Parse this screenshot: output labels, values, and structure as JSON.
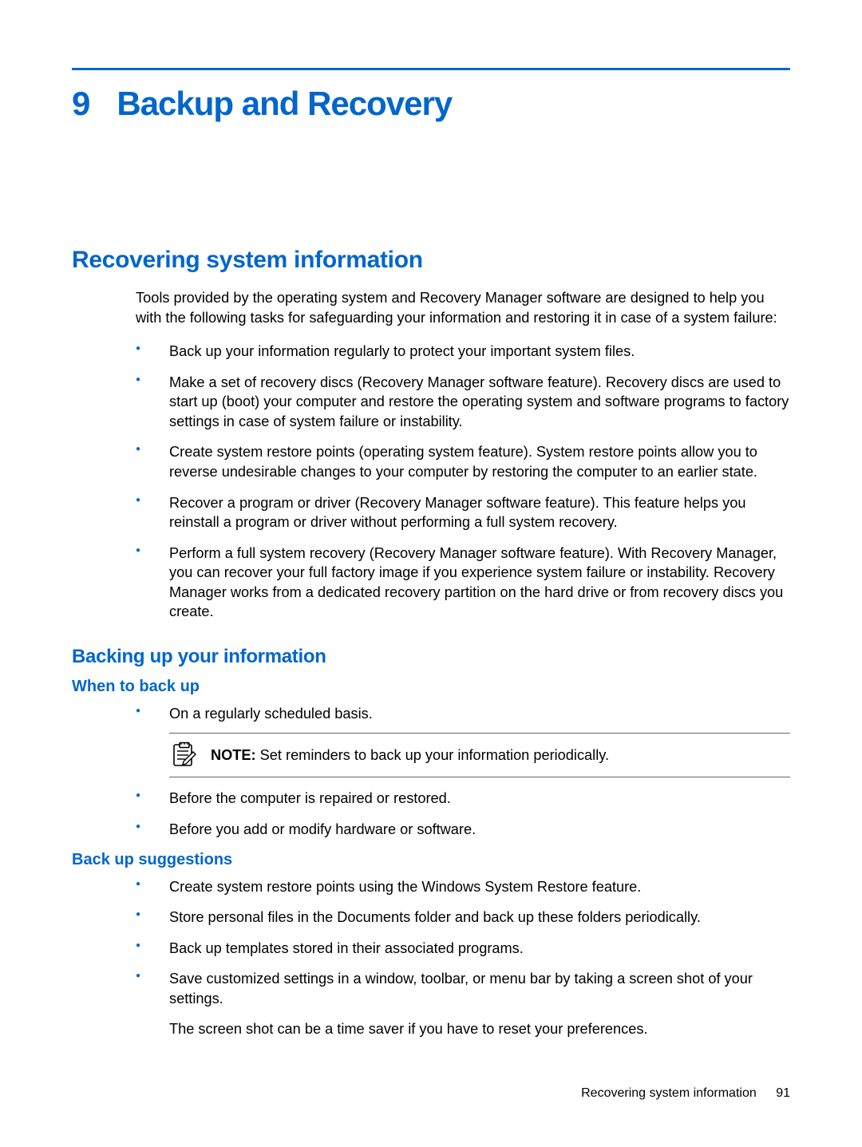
{
  "chapter": {
    "number": "9",
    "title": "Backup and Recovery"
  },
  "section": {
    "heading": "Recovering system information",
    "intro": "Tools provided by the operating system and Recovery Manager software are designed to help you with the following tasks for safeguarding your information and restoring it in case of a system failure:",
    "bullets": [
      "Back up your information regularly to protect your important system files.",
      "Make a set of recovery discs (Recovery Manager software feature). Recovery discs are used to start up (boot) your computer and restore the operating system and software programs to factory settings in case of system failure or instability.",
      "Create system restore points (operating system feature). System restore points allow you to reverse undesirable changes to your computer by restoring the computer to an earlier state.",
      "Recover a program or driver (Recovery Manager software feature). This feature helps you reinstall a program or driver without performing a full system recovery.",
      "Perform a full system recovery (Recovery Manager software feature). With Recovery Manager, you can recover your full factory image if you experience system failure or instability. Recovery Manager works from a dedicated recovery partition on the hard drive or from recovery discs you create."
    ]
  },
  "subsection": {
    "heading": "Backing up your information",
    "when": {
      "heading": "When to back up",
      "items_before_note": [
        "On a regularly scheduled basis."
      ],
      "note": {
        "label": "NOTE:",
        "text": "Set reminders to back up your information periodically."
      },
      "items_after_note": [
        "Before the computer is repaired or restored.",
        "Before you add or modify hardware or software."
      ]
    },
    "suggestions": {
      "heading": "Back up suggestions",
      "items": [
        "Create system restore points using the Windows System Restore feature.",
        "Store personal files in the Documents folder and back up these folders periodically.",
        "Back up templates stored in their associated programs."
      ],
      "last_item_main": "Save customized settings in a window, toolbar, or menu bar by taking a screen shot of your settings.",
      "last_item_sub": "The screen shot can be a time saver if you have to reset your preferences."
    }
  },
  "footer": {
    "title": "Recovering system information",
    "page": "91"
  }
}
